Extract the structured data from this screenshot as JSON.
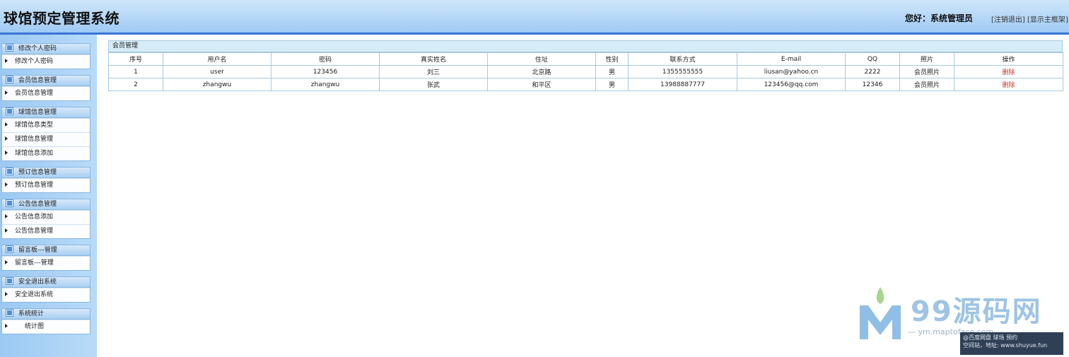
{
  "app": {
    "title": "球馆预定管理系统",
    "greeting": "您好：系统管理员",
    "links": [
      "[注销退出]",
      "[显示主框架]"
    ]
  },
  "sidebar": {
    "groups": [
      {
        "title": "修改个人密码",
        "items": [
          "修改个人密码"
        ]
      },
      {
        "title": "会员信息管理",
        "items": [
          "会员信息管理"
        ]
      },
      {
        "title": "球馆信息管理",
        "items": [
          "球馆信息类型",
          "球馆信息管理",
          "球馆信息添加"
        ]
      },
      {
        "title": "预订信息管理",
        "items": [
          "预订信息管理"
        ]
      },
      {
        "title": "公告信息管理",
        "items": [
          "公告信息添加",
          "公告信息管理"
        ]
      },
      {
        "title": "留言板---管理",
        "items": [
          "留言板---管理"
        ]
      },
      {
        "title": "安全退出系统",
        "items": [
          "安全退出系统"
        ]
      },
      {
        "title": "系统统计",
        "items": [
          "统计图"
        ]
      }
    ]
  },
  "main": {
    "panel_title": "会员管理",
    "columns": [
      "序号",
      "用户名",
      "密码",
      "真实姓名",
      "住址",
      "性别",
      "联系方式",
      "E-mail",
      "QQ",
      "照片",
      "操作"
    ],
    "rows": [
      [
        "1",
        "user",
        "123456",
        "刘三",
        "北京路",
        "男",
        "1355555555",
        "liusan@yahoo.cn",
        "2222",
        "会员照片",
        "删除"
      ],
      [
        "2",
        "zhangwu",
        "zhangwu",
        "张武",
        "和平区",
        "男",
        "13988887777",
        "123456@qq.com",
        "12346",
        "会员照片",
        "删除"
      ]
    ]
  },
  "watermark": {
    "brand": "99源码网",
    "sub": "— ym.maptoface.com —",
    "bar_line1": "@百度网盘 球场 预约",
    "bar_line2": "空间站，地址: www.shuyue.fun"
  },
  "colors": {
    "header_top": "#cfe6fb",
    "header_bottom": "#9fcaf4",
    "header_border": "#3c74d6",
    "sidebar_bg": "#9bc9f3",
    "delete_link": "#c0392b"
  }
}
